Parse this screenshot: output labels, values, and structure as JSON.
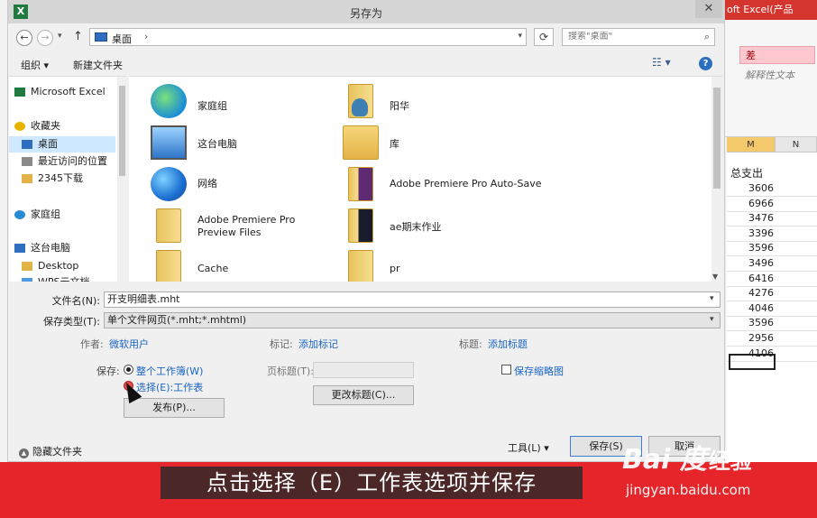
{
  "excel": {
    "title_fragment": "oft Excel(产品",
    "style_bad": "差",
    "style_explain": "解释性文本",
    "columns": [
      "M",
      "N"
    ],
    "header_cell": "总支出",
    "values": [
      "3606",
      "6966",
      "3476",
      "3396",
      "3596",
      "3496",
      "6416",
      "4276",
      "4046",
      "3596",
      "2956",
      "4106"
    ]
  },
  "dialog": {
    "title": "另存为",
    "close_glyph": "✕",
    "app_icon_letter": "X",
    "address": {
      "path": "桌面",
      "sep": "›"
    },
    "search_placeholder": "搜索\"桌面\"",
    "toolbar": {
      "organize": "组织 ▾",
      "new_folder": "新建文件夹",
      "view": "☷ ▾",
      "help": "?"
    },
    "nav_items": [
      {
        "label": "Microsoft Excel",
        "icon": "excel-icon"
      },
      {
        "label": "收藏夹",
        "icon": "star-icon"
      },
      {
        "label": "桌面",
        "icon": "desktop-icon",
        "selected": true
      },
      {
        "label": "最近访问的位置",
        "icon": "recent-places-icon"
      },
      {
        "label": "2345下载",
        "icon": "folder-icon"
      },
      {
        "label": "家庭组",
        "icon": "homegroup-icon"
      },
      {
        "label": "这台电脑",
        "icon": "computer-icon"
      },
      {
        "label": "Desktop",
        "icon": "folder-icon"
      },
      {
        "label": "WPS云文档",
        "icon": "cloud-icon"
      }
    ],
    "files": [
      {
        "label": "家庭组",
        "icon": "homegroup-icon"
      },
      {
        "label": "阳华",
        "icon": "user-folder-icon"
      },
      {
        "label": "这台电脑",
        "icon": "computer-icon"
      },
      {
        "label": "库",
        "icon": "library-icon"
      },
      {
        "label": "网络",
        "icon": "network-icon"
      },
      {
        "label": "Adobe Premiere Pro Auto-Save",
        "icon": "premiere-folder-icon"
      },
      {
        "label": "Adobe Premiere Pro Preview Files",
        "icon": "folder-icon"
      },
      {
        "label": "ae期末作业",
        "icon": "ae-folder-icon"
      },
      {
        "label": "Cache",
        "icon": "folder-icon"
      },
      {
        "label": "pr",
        "icon": "folder-icon"
      }
    ],
    "form": {
      "filename_label": "文件名(N):",
      "filename_value": "开支明细表.mht",
      "filetype_label": "保存类型(T):",
      "filetype_value": "单个文件网页(*.mht;*.mhtml)",
      "author_label": "作者:",
      "author_value": "微软用户",
      "tags_label": "标记:",
      "tags_value": "添加标记",
      "title_label": "标题:",
      "title_value": "添加标题",
      "save_label": "保存:",
      "radio_workbook": "整个工作簿(W)",
      "radio_sheet": "选择(E):工作表",
      "page_title_label": "页标题(T):",
      "change_title": "更改标题(C)...",
      "publish": "发布(P)...",
      "save_thumbnail": "保存缩略图"
    },
    "footer": {
      "hide_folders": "隐藏文件夹",
      "tools": "工具(L) ▾",
      "save": "保存(S)",
      "cancel": "取消"
    }
  },
  "overlay": {
    "caption": "点击选择（E）工作表选项并保存",
    "baidu_logo": "Bai 度",
    "baidu_jingyan": "经验",
    "baidu_url": "jingyan.baidu.com"
  }
}
